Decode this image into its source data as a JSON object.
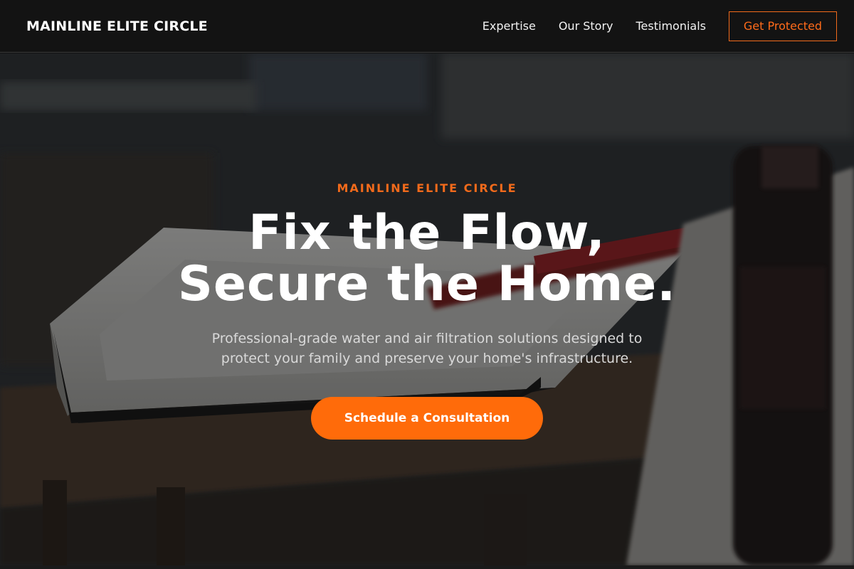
{
  "nav": {
    "brand": "MAINLINE ELITE CIRCLE",
    "links": [
      {
        "label": "Expertise"
      },
      {
        "label": "Our Story"
      },
      {
        "label": "Testimonials"
      }
    ],
    "cta_label": "Get Protected"
  },
  "hero": {
    "eyebrow": "MAINLINE ELITE CIRCLE",
    "headline_line1": "Fix the Flow,",
    "headline_line2": "Secure the Home.",
    "subtitle": "Professional-grade water and air filtration solutions designed to protect your family and preserve your home's infrastructure.",
    "cta_label": "Schedule a Consultation"
  },
  "colors": {
    "accent": "#ff6b0a",
    "nav_background": "#131313"
  }
}
